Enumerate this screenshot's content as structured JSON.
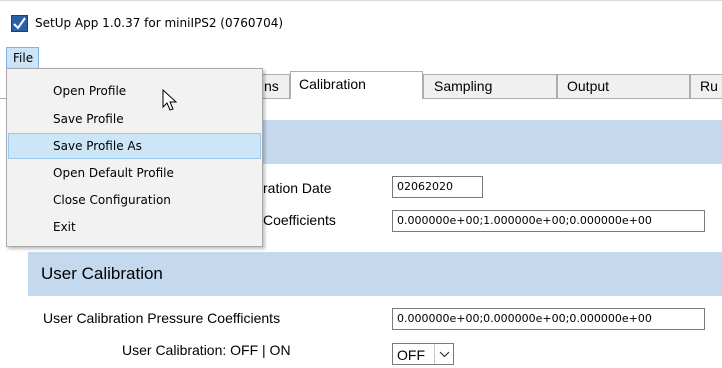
{
  "window": {
    "title": "SetUp App 1.0.37 for miniIPS2 (0760704)",
    "icon": "app-check-icon"
  },
  "menubar": {
    "file_label": "File"
  },
  "file_menu": {
    "items": [
      {
        "label": "Open Profile"
      },
      {
        "label": "Save Profile"
      },
      {
        "label": "Save Profile As",
        "highlighted": true
      },
      {
        "label": "Open Default Profile"
      },
      {
        "label": "Close Configuration"
      },
      {
        "label": "Exit"
      }
    ]
  },
  "tabs": [
    {
      "label": "ns",
      "partial": true
    },
    {
      "label": "Calibration",
      "active": true
    },
    {
      "label": "Sampling"
    },
    {
      "label": "Output"
    },
    {
      "label": "Ru",
      "partial": true
    }
  ],
  "factory_section": {
    "calibration_date_label": "ration Date",
    "calibration_date_value": "02062020",
    "coefficients_label": "Coefficients",
    "coefficients_value": "0.000000e+00;1.000000e+00;0.000000e+00"
  },
  "user_section": {
    "title": "User Calibration",
    "pressure_coefficients_label": "User Calibration Pressure Coefficients",
    "pressure_coefficients_value": "0.000000e+00;0.000000e+00;0.000000e+00",
    "toggle_label": "User Calibration: OFF | ON",
    "toggle_value": "OFF"
  },
  "colors": {
    "section_header": "#c5d9ee",
    "menu_highlight": "#cde6f7",
    "file_menu_active": "#cce4f7"
  }
}
